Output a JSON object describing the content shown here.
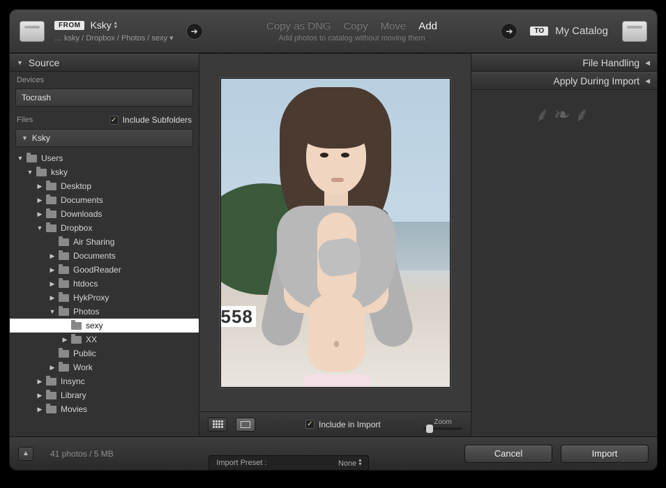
{
  "top": {
    "from_chip": "FROM",
    "from_name": "Ksky",
    "from_path": "… ksky / Dropbox / Photos / sexy ▾",
    "modes": {
      "copy_dng": "Copy as DNG",
      "copy": "Copy",
      "move": "Move",
      "add": "Add"
    },
    "mode_subtitle": "Add photos to catalog without moving them",
    "to_chip": "TO",
    "to_name": "My Catalog"
  },
  "left": {
    "source_title": "Source",
    "devices_label": "Devices",
    "device_selected": "Tocrash",
    "files_label": "Files",
    "include_subfolders": "Include Subfolders",
    "drive_name": "Ksky",
    "tree": {
      "users": "Users",
      "ksky": "ksky",
      "desktop": "Desktop",
      "documents": "Documents",
      "downloads": "Downloads",
      "dropbox": "Dropbox",
      "air_sharing": "Air Sharing",
      "documents2": "Documents",
      "goodreader": "GoodReader",
      "htdocs": "htdocs",
      "hykproxy": "HykProxy",
      "photos": "Photos",
      "sexy": "sexy",
      "xx": "XX",
      "public": "Public",
      "work": "Work",
      "insync": "Insync",
      "library": "Library",
      "movies": "Movies"
    }
  },
  "center": {
    "number_overlay": "558",
    "include_in_import": "Include in Import",
    "zoom_label": "Zoom"
  },
  "right": {
    "file_handling": "File Handling",
    "apply_during_import": "Apply During Import"
  },
  "footer": {
    "count": "41 photos / 5 MB",
    "preset_label": "Import Preset :",
    "preset_value": "None",
    "cancel": "Cancel",
    "import": "Import"
  }
}
